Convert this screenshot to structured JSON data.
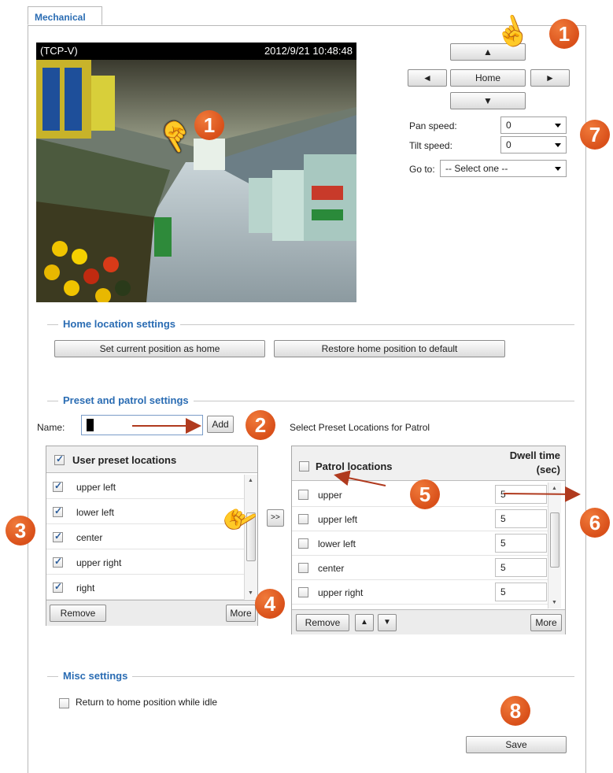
{
  "tab": {
    "label": "Mechanical"
  },
  "video": {
    "stream": "(TCP-V)",
    "timestamp": "2012/9/21 10:48:48"
  },
  "ptz": {
    "up_symbol": "▲",
    "down_symbol": "▼",
    "left_symbol": "◄",
    "right_symbol": "►",
    "home_label": "Home",
    "pan_speed_label": "Pan speed:",
    "pan_speed_value": "0",
    "tilt_speed_label": "Tilt speed:",
    "tilt_speed_value": "0",
    "goto_label": "Go to:",
    "goto_value": "-- Select one --"
  },
  "home_settings": {
    "title": "Home location settings",
    "set_home_label": "Set current position as home",
    "restore_home_label": "Restore home position to default"
  },
  "preset_settings": {
    "title": "Preset and patrol settings",
    "name_label": "Name:",
    "name_value": "",
    "add_label": "Add",
    "patrol_caption": "Select Preset Locations for Patrol",
    "move_label": ">>",
    "user_presets": {
      "header": "User preset locations",
      "items": [
        {
          "label": "upper left",
          "checked": true
        },
        {
          "label": "lower left",
          "checked": true
        },
        {
          "label": "center",
          "checked": true
        },
        {
          "label": "upper right",
          "checked": true
        },
        {
          "label": "right",
          "checked": true
        }
      ],
      "remove_label": "Remove",
      "more_label": "More"
    },
    "patrol": {
      "header": "Patrol locations",
      "dwell_header_1": "Dwell time",
      "dwell_header_2": "(sec)",
      "items": [
        {
          "label": "upper",
          "dwell": "5"
        },
        {
          "label": "upper left",
          "dwell": "5"
        },
        {
          "label": "lower left",
          "dwell": "5"
        },
        {
          "label": "center",
          "dwell": "5"
        },
        {
          "label": "upper right",
          "dwell": "5"
        }
      ],
      "remove_label": "Remove",
      "up_symbol": "▲",
      "down_symbol": "▼",
      "more_label": "More"
    }
  },
  "misc_settings": {
    "title": "Misc settings",
    "idle_label": "Return to home position while idle",
    "idle_checked": false,
    "save_label": "Save"
  },
  "callouts": [
    "1",
    "1",
    "2",
    "3",
    "4",
    "5",
    "6",
    "7",
    "8"
  ],
  "colors": {
    "accent": "#2a6cb3",
    "badge": "#e0571f",
    "arrow": "#b03a1e"
  }
}
